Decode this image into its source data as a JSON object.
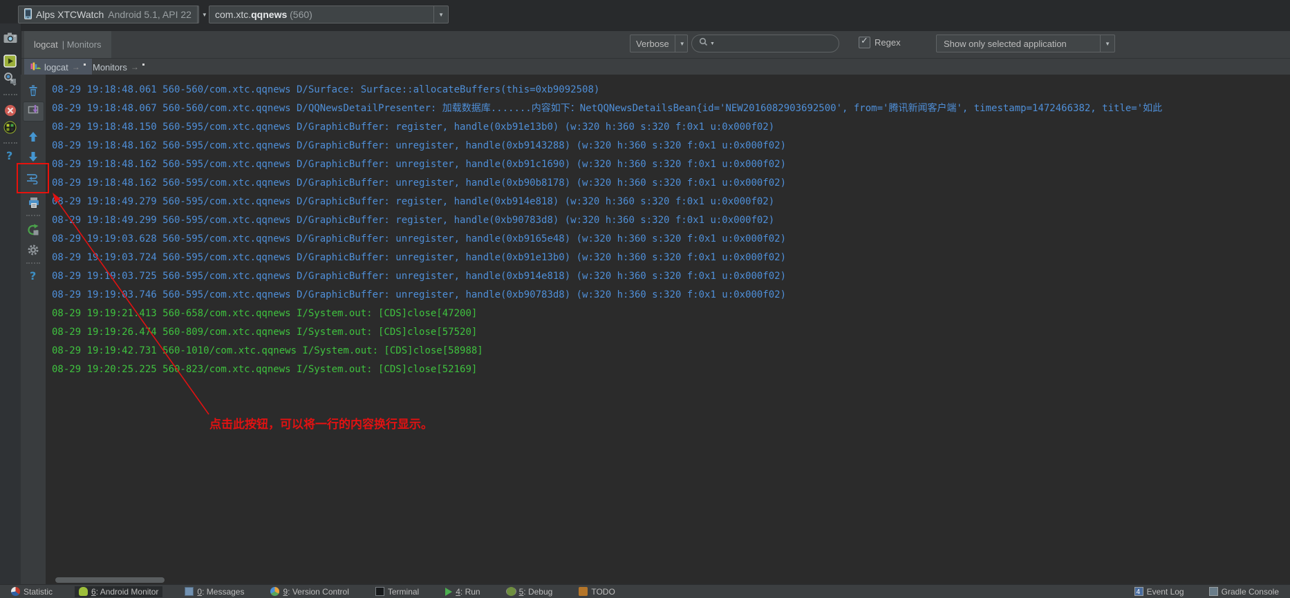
{
  "header": {
    "device": {
      "name": "Alps XTCWatch",
      "api": "Android 5.1, API 22"
    },
    "process": {
      "prefix": "com.xtc.",
      "bold": "qqnews",
      "pid": "(560)"
    }
  },
  "toolwindow": {
    "title_primary": "logcat",
    "title_secondary": "| Monitors",
    "log_level": "Verbose",
    "regex_label": "Regex",
    "filter_label": "Show only selected application"
  },
  "search": {
    "value": "",
    "placeholder": ""
  },
  "tabs": [
    {
      "label": "logcat",
      "selected": true
    },
    {
      "label": "Monitors",
      "selected": false
    }
  ],
  "colors": {
    "debug": "#4f8fd8",
    "info": "#3fc23f",
    "annotation": "#e01212",
    "panel": "#3c3f41",
    "editor_bg": "#2b2b2b"
  },
  "log": {
    "lines": [
      {
        "level": "debug",
        "text": "08-29 19:18:48.061 560-560/com.xtc.qqnews D/Surface: Surface::allocateBuffers(this=0xb9092508)"
      },
      {
        "level": "debug",
        "text": "08-29 19:18:48.067 560-560/com.xtc.qqnews D/QQNewsDetailPresenter: 加载数据库.......内容如下：NetQQNewsDetailsBean{id='NEW2016082903692500', from='腾讯新闻客户端', timestamp=1472466382, title='如此"
      },
      {
        "level": "debug",
        "text": "08-29 19:18:48.150 560-595/com.xtc.qqnews D/GraphicBuffer: register, handle(0xb91e13b0) (w:320 h:360 s:320 f:0x1 u:0x000f02)"
      },
      {
        "level": "debug",
        "text": "08-29 19:18:48.162 560-595/com.xtc.qqnews D/GraphicBuffer: unregister, handle(0xb9143288) (w:320 h:360 s:320 f:0x1 u:0x000f02)"
      },
      {
        "level": "debug",
        "text": "08-29 19:18:48.162 560-595/com.xtc.qqnews D/GraphicBuffer: unregister, handle(0xb91c1690) (w:320 h:360 s:320 f:0x1 u:0x000f02)"
      },
      {
        "level": "debug",
        "text": "08-29 19:18:48.162 560-595/com.xtc.qqnews D/GraphicBuffer: unregister, handle(0xb90b8178) (w:320 h:360 s:320 f:0x1 u:0x000f02)"
      },
      {
        "level": "debug",
        "text": "08-29 19:18:49.279 560-595/com.xtc.qqnews D/GraphicBuffer: register, handle(0xb914e818) (w:320 h:360 s:320 f:0x1 u:0x000f02)"
      },
      {
        "level": "debug",
        "text": "08-29 19:18:49.299 560-595/com.xtc.qqnews D/GraphicBuffer: register, handle(0xb90783d8) (w:320 h:360 s:320 f:0x1 u:0x000f02)"
      },
      {
        "level": "debug",
        "text": "08-29 19:19:03.628 560-595/com.xtc.qqnews D/GraphicBuffer: unregister, handle(0xb9165e48) (w:320 h:360 s:320 f:0x1 u:0x000f02)"
      },
      {
        "level": "debug",
        "text": "08-29 19:19:03.724 560-595/com.xtc.qqnews D/GraphicBuffer: unregister, handle(0xb91e13b0) (w:320 h:360 s:320 f:0x1 u:0x000f02)"
      },
      {
        "level": "debug",
        "text": "08-29 19:19:03.725 560-595/com.xtc.qqnews D/GraphicBuffer: unregister, handle(0xb914e818) (w:320 h:360 s:320 f:0x1 u:0x000f02)"
      },
      {
        "level": "debug",
        "text": "08-29 19:19:03.746 560-595/com.xtc.qqnews D/GraphicBuffer: unregister, handle(0xb90783d8) (w:320 h:360 s:320 f:0x1 u:0x000f02)"
      },
      {
        "level": "info",
        "text": "08-29 19:19:21.413 560-658/com.xtc.qqnews I/System.out: [CDS]close[47200]"
      },
      {
        "level": "info",
        "text": "08-29 19:19:26.474 560-809/com.xtc.qqnews I/System.out: [CDS]close[57520]"
      },
      {
        "level": "info",
        "text": "08-29 19:19:42.731 560-1010/com.xtc.qqnews I/System.out: [CDS]close[58988]"
      },
      {
        "level": "info",
        "text": "08-29 19:20:25.225 560-823/com.xtc.qqnews I/System.out: [CDS]close[52169]"
      }
    ]
  },
  "annotation": {
    "text": "点击此按钮，可以将一行的内容换行显示。"
  },
  "status_bar": {
    "left": [
      {
        "icon": "statistic-icon",
        "mnemonic": "",
        "label": "Statistic",
        "active": false
      },
      {
        "icon": "android-icon",
        "mnemonic": "6",
        "label": ": Android Monitor",
        "active": true
      },
      {
        "icon": "messages-icon",
        "mnemonic": "0",
        "label": ": Messages",
        "active": false
      },
      {
        "icon": "version-control-icon",
        "mnemonic": "9",
        "label": ": Version Control",
        "active": false
      },
      {
        "icon": "terminal-icon",
        "mnemonic": "",
        "label": "Terminal",
        "active": false
      },
      {
        "icon": "run-icon",
        "mnemonic": "4",
        "label": ": Run",
        "active": false
      },
      {
        "icon": "debug-icon",
        "mnemonic": "5",
        "label": ": Debug",
        "active": false
      },
      {
        "icon": "todo-icon",
        "mnemonic": "",
        "label": "TODO",
        "active": false
      }
    ],
    "right": [
      {
        "icon": "event-log-icon",
        "badge": "4",
        "label": "Event Log"
      },
      {
        "icon": "gradle-console-icon",
        "badge": "",
        "label": "Gradle Console"
      }
    ]
  },
  "icons": [
    "device-phone-icon",
    "chevron-down-icon",
    "search-icon",
    "camera-icon",
    "screen-record-icon",
    "layout-inspector-icon",
    "terminate-icon",
    "system-info-icon",
    "help-icon",
    "trash-icon",
    "scroll-to-end-icon",
    "up-stack-trace-icon",
    "down-stack-trace-icon",
    "wrap-lines-icon",
    "print-icon",
    "restart-icon",
    "gear-icon",
    "logcat-tab-icon"
  ]
}
